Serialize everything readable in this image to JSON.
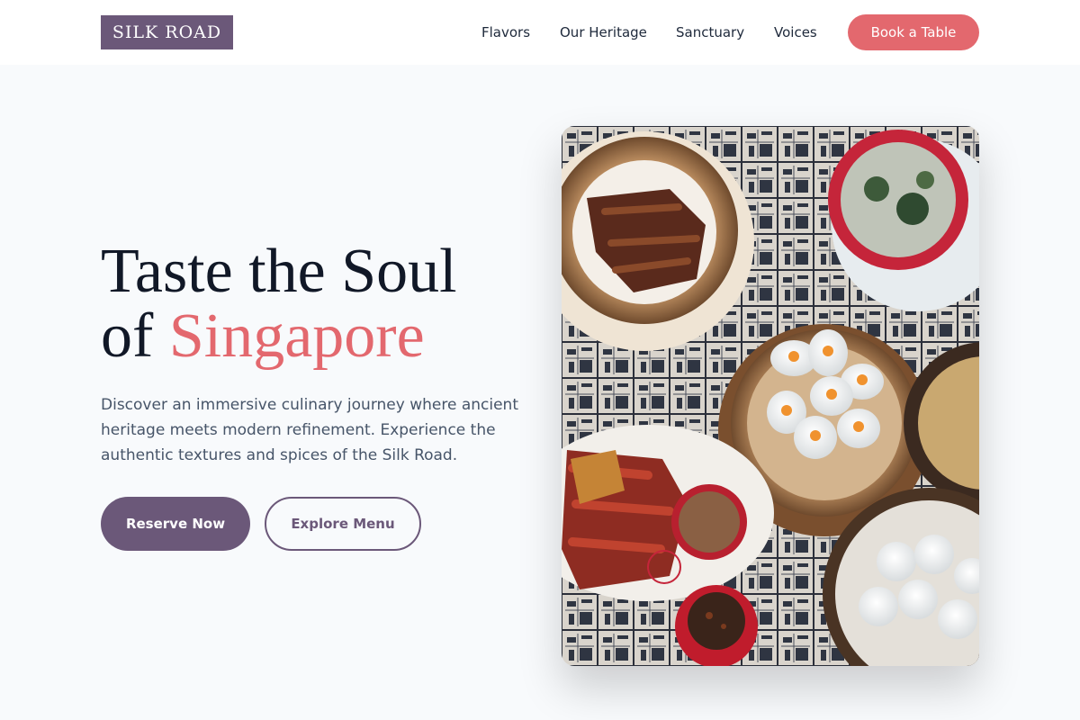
{
  "header": {
    "logo": "SILK ROAD",
    "nav": [
      {
        "label": "Flavors"
      },
      {
        "label": "Our Heritage"
      },
      {
        "label": "Sanctuary"
      },
      {
        "label": "Voices"
      }
    ],
    "cta": "Book a Table"
  },
  "hero": {
    "title_line1": "Taste the Soul",
    "title_of": "of",
    "title_accent": "Singapore",
    "description": "Discover an immersive culinary journey where ancient heritage meets modern refinement. Experience the authentic textures and spices of the Silk Road.",
    "primary_button": "Reserve Now",
    "secondary_button": "Explore Menu",
    "image_alt": "Overhead view of dim sum dishes on a patterned table"
  },
  "colors": {
    "brand_purple": "#6b5879",
    "accent_coral": "#e3686e",
    "background": "#f8fafc",
    "heading": "#111827",
    "body_text": "#475569"
  }
}
